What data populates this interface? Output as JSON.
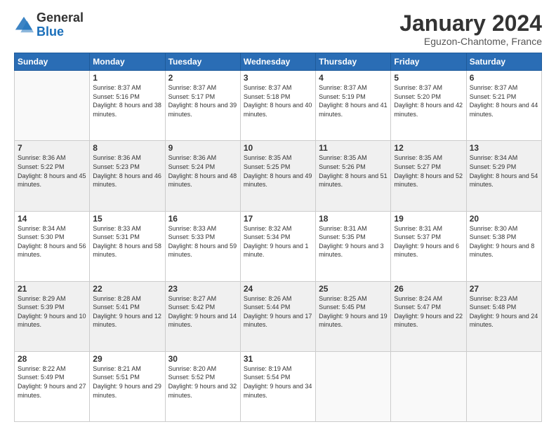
{
  "header": {
    "logo": {
      "general": "General",
      "blue": "Blue"
    },
    "title": "January 2024",
    "location": "Eguzon-Chantome, France"
  },
  "weekdays": [
    "Sunday",
    "Monday",
    "Tuesday",
    "Wednesday",
    "Thursday",
    "Friday",
    "Saturday"
  ],
  "weeks": [
    [
      {
        "day": "",
        "sunrise": "",
        "sunset": "",
        "daylight": ""
      },
      {
        "day": "1",
        "sunrise": "Sunrise: 8:37 AM",
        "sunset": "Sunset: 5:16 PM",
        "daylight": "Daylight: 8 hours and 38 minutes."
      },
      {
        "day": "2",
        "sunrise": "Sunrise: 8:37 AM",
        "sunset": "Sunset: 5:17 PM",
        "daylight": "Daylight: 8 hours and 39 minutes."
      },
      {
        "day": "3",
        "sunrise": "Sunrise: 8:37 AM",
        "sunset": "Sunset: 5:18 PM",
        "daylight": "Daylight: 8 hours and 40 minutes."
      },
      {
        "day": "4",
        "sunrise": "Sunrise: 8:37 AM",
        "sunset": "Sunset: 5:19 PM",
        "daylight": "Daylight: 8 hours and 41 minutes."
      },
      {
        "day": "5",
        "sunrise": "Sunrise: 8:37 AM",
        "sunset": "Sunset: 5:20 PM",
        "daylight": "Daylight: 8 hours and 42 minutes."
      },
      {
        "day": "6",
        "sunrise": "Sunrise: 8:37 AM",
        "sunset": "Sunset: 5:21 PM",
        "daylight": "Daylight: 8 hours and 44 minutes."
      }
    ],
    [
      {
        "day": "7",
        "sunrise": "Sunrise: 8:36 AM",
        "sunset": "Sunset: 5:22 PM",
        "daylight": "Daylight: 8 hours and 45 minutes."
      },
      {
        "day": "8",
        "sunrise": "Sunrise: 8:36 AM",
        "sunset": "Sunset: 5:23 PM",
        "daylight": "Daylight: 8 hours and 46 minutes."
      },
      {
        "day": "9",
        "sunrise": "Sunrise: 8:36 AM",
        "sunset": "Sunset: 5:24 PM",
        "daylight": "Daylight: 8 hours and 48 minutes."
      },
      {
        "day": "10",
        "sunrise": "Sunrise: 8:35 AM",
        "sunset": "Sunset: 5:25 PM",
        "daylight": "Daylight: 8 hours and 49 minutes."
      },
      {
        "day": "11",
        "sunrise": "Sunrise: 8:35 AM",
        "sunset": "Sunset: 5:26 PM",
        "daylight": "Daylight: 8 hours and 51 minutes."
      },
      {
        "day": "12",
        "sunrise": "Sunrise: 8:35 AM",
        "sunset": "Sunset: 5:27 PM",
        "daylight": "Daylight: 8 hours and 52 minutes."
      },
      {
        "day": "13",
        "sunrise": "Sunrise: 8:34 AM",
        "sunset": "Sunset: 5:29 PM",
        "daylight": "Daylight: 8 hours and 54 minutes."
      }
    ],
    [
      {
        "day": "14",
        "sunrise": "Sunrise: 8:34 AM",
        "sunset": "Sunset: 5:30 PM",
        "daylight": "Daylight: 8 hours and 56 minutes."
      },
      {
        "day": "15",
        "sunrise": "Sunrise: 8:33 AM",
        "sunset": "Sunset: 5:31 PM",
        "daylight": "Daylight: 8 hours and 58 minutes."
      },
      {
        "day": "16",
        "sunrise": "Sunrise: 8:33 AM",
        "sunset": "Sunset: 5:33 PM",
        "daylight": "Daylight: 8 hours and 59 minutes."
      },
      {
        "day": "17",
        "sunrise": "Sunrise: 8:32 AM",
        "sunset": "Sunset: 5:34 PM",
        "daylight": "Daylight: 9 hours and 1 minute."
      },
      {
        "day": "18",
        "sunrise": "Sunrise: 8:31 AM",
        "sunset": "Sunset: 5:35 PM",
        "daylight": "Daylight: 9 hours and 3 minutes."
      },
      {
        "day": "19",
        "sunrise": "Sunrise: 8:31 AM",
        "sunset": "Sunset: 5:37 PM",
        "daylight": "Daylight: 9 hours and 6 minutes."
      },
      {
        "day": "20",
        "sunrise": "Sunrise: 8:30 AM",
        "sunset": "Sunset: 5:38 PM",
        "daylight": "Daylight: 9 hours and 8 minutes."
      }
    ],
    [
      {
        "day": "21",
        "sunrise": "Sunrise: 8:29 AM",
        "sunset": "Sunset: 5:39 PM",
        "daylight": "Daylight: 9 hours and 10 minutes."
      },
      {
        "day": "22",
        "sunrise": "Sunrise: 8:28 AM",
        "sunset": "Sunset: 5:41 PM",
        "daylight": "Daylight: 9 hours and 12 minutes."
      },
      {
        "day": "23",
        "sunrise": "Sunrise: 8:27 AM",
        "sunset": "Sunset: 5:42 PM",
        "daylight": "Daylight: 9 hours and 14 minutes."
      },
      {
        "day": "24",
        "sunrise": "Sunrise: 8:26 AM",
        "sunset": "Sunset: 5:44 PM",
        "daylight": "Daylight: 9 hours and 17 minutes."
      },
      {
        "day": "25",
        "sunrise": "Sunrise: 8:25 AM",
        "sunset": "Sunset: 5:45 PM",
        "daylight": "Daylight: 9 hours and 19 minutes."
      },
      {
        "day": "26",
        "sunrise": "Sunrise: 8:24 AM",
        "sunset": "Sunset: 5:47 PM",
        "daylight": "Daylight: 9 hours and 22 minutes."
      },
      {
        "day": "27",
        "sunrise": "Sunrise: 8:23 AM",
        "sunset": "Sunset: 5:48 PM",
        "daylight": "Daylight: 9 hours and 24 minutes."
      }
    ],
    [
      {
        "day": "28",
        "sunrise": "Sunrise: 8:22 AM",
        "sunset": "Sunset: 5:49 PM",
        "daylight": "Daylight: 9 hours and 27 minutes."
      },
      {
        "day": "29",
        "sunrise": "Sunrise: 8:21 AM",
        "sunset": "Sunset: 5:51 PM",
        "daylight": "Daylight: 9 hours and 29 minutes."
      },
      {
        "day": "30",
        "sunrise": "Sunrise: 8:20 AM",
        "sunset": "Sunset: 5:52 PM",
        "daylight": "Daylight: 9 hours and 32 minutes."
      },
      {
        "day": "31",
        "sunrise": "Sunrise: 8:19 AM",
        "sunset": "Sunset: 5:54 PM",
        "daylight": "Daylight: 9 hours and 34 minutes."
      },
      {
        "day": "",
        "sunrise": "",
        "sunset": "",
        "daylight": ""
      },
      {
        "day": "",
        "sunrise": "",
        "sunset": "",
        "daylight": ""
      },
      {
        "day": "",
        "sunrise": "",
        "sunset": "",
        "daylight": ""
      }
    ]
  ]
}
